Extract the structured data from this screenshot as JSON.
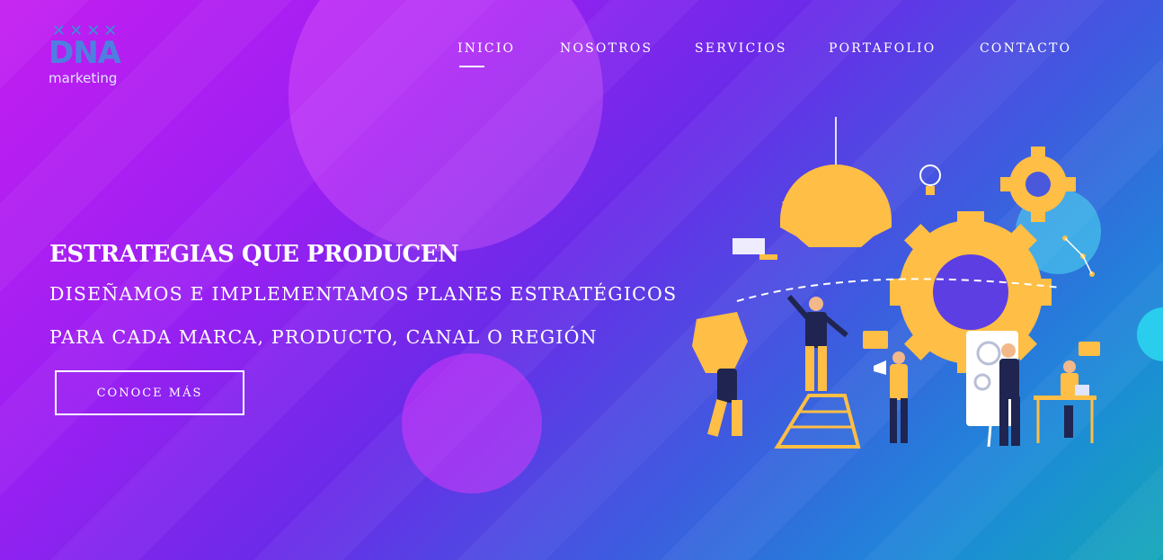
{
  "logo": {
    "brand": "DNA",
    "tagline": "marketing",
    "icon": "people-chain-icon"
  },
  "nav": {
    "items": [
      "INICIO",
      "NOSOTROS",
      "SERVICIOS",
      "PORTAFOLIO",
      "CONTACTO"
    ],
    "active_index": 0
  },
  "hero": {
    "title": "ESTRATEGIAS QUE PRODUCEN",
    "line1": "DISEÑAMOS E IMPLEMENTAMOS PLANES ESTRATÉGICOS",
    "line2": "PARA CADA MARCA, PRODUCTO, CANAL O REGIÓN",
    "cta_label": "CONOCE MÁS"
  },
  "illustration": {
    "icon": "teamwork-gears-illustration"
  },
  "colors": {
    "accent_yellow": "#ffbe45",
    "navy": "#1f2550",
    "white": "#ffffff"
  }
}
